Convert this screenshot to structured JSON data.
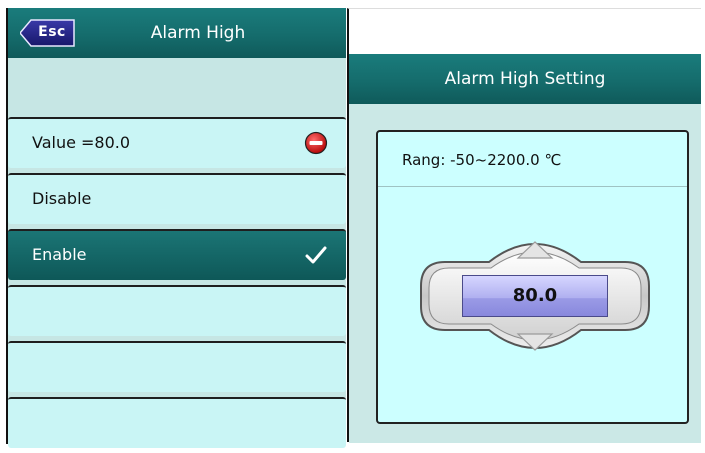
{
  "left": {
    "esc_label": "Esc",
    "title": "Alarm High",
    "items": [
      {
        "label": "Value =80.0"
      },
      {
        "label": "Disable"
      },
      {
        "label": "Enable"
      },
      {
        "label": ""
      },
      {
        "label": ""
      },
      {
        "label": ""
      }
    ],
    "selected_index": 2
  },
  "right": {
    "title": "Alarm High Setting",
    "range_text": "Rang: -50~2200.0 ℃",
    "value": "80.0"
  },
  "colors": {
    "header": "#156c6c",
    "list_bg": "#c9f5f5",
    "selected_bg": "#0e5858",
    "panel_bg": "#ccffff",
    "value_box": "#b0b0f0"
  },
  "icons": {
    "back": "esc-arrow-icon",
    "stop": "no-entry-icon",
    "check": "checkmark-icon",
    "up": "triangle-up-icon",
    "down": "triangle-down-icon"
  }
}
